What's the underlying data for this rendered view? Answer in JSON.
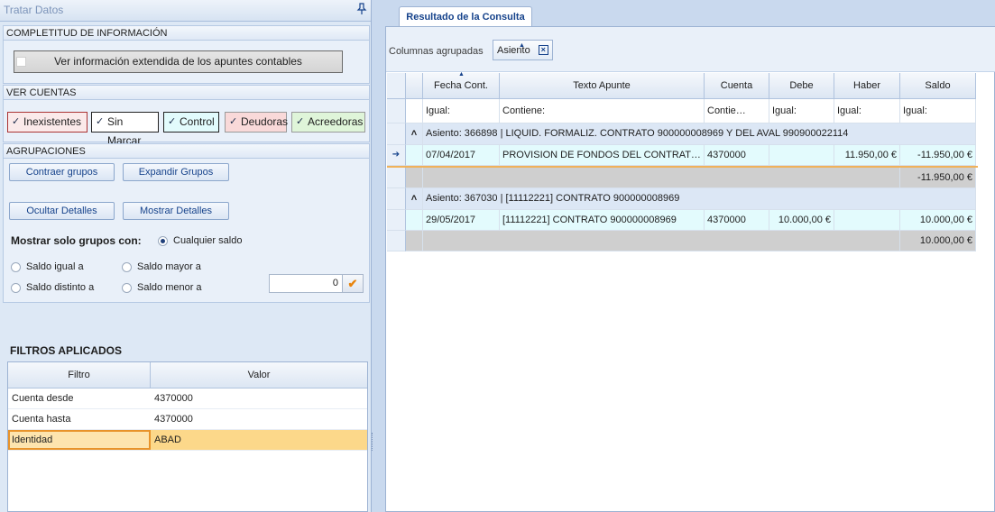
{
  "left_panel": {
    "title": "Tratar Datos",
    "completeness": {
      "header": "COMPLETITUD DE INFORMACIÓN",
      "extended_button": "Ver información extendida de los apuntes contables"
    },
    "accounts": {
      "header": "VER CUENTAS",
      "chips": [
        {
          "label": "Inexistentes",
          "checked": true,
          "color": "#fbeaea",
          "border": "#a33"
        },
        {
          "label": "Sin Marcar",
          "checked": true,
          "color": "#ffffff",
          "border": "#222"
        },
        {
          "label": "Control",
          "checked": true,
          "color": "#e2fbfc",
          "border": "#222"
        },
        {
          "label": "Deudoras",
          "checked": true,
          "color": "#f9d9d9",
          "border": "#999"
        },
        {
          "label": "Acreedoras",
          "checked": true,
          "color": "#dff5d9",
          "border": "#999"
        }
      ]
    },
    "groupings": {
      "header": "AGRUPACIONES",
      "collapse": "Contraer grupos",
      "expand": "Expandir Grupos",
      "hide_details": "Ocultar Detalles",
      "show_details": "Mostrar Detalles",
      "only_groups_label": "Mostrar solo grupos con:",
      "radio_any": "Cualquier saldo",
      "radio_equal": "Saldo igual a",
      "radio_greater": "Saldo mayor a",
      "radio_distinct": "Saldo distinto a",
      "radio_less": "Saldo menor a",
      "selected_radio": "Cualquier saldo",
      "amount_value": "0"
    },
    "filters": {
      "title": "FILTROS APLICADOS",
      "col_filter": "Filtro",
      "col_value": "Valor",
      "rows": [
        {
          "filter": "Cuenta desde",
          "value": "4370000"
        },
        {
          "filter": "Cuenta hasta",
          "value": "4370000"
        },
        {
          "filter": "Identidad",
          "value": "ABAD"
        }
      ]
    }
  },
  "right_panel": {
    "tab_label": "Resultado de la Consulta",
    "group_bar_label": "Columnas agrupadas",
    "group_chip": "Asiento",
    "columns": [
      "Fecha Cont.",
      "Texto Apunte",
      "Cuenta",
      "Debe",
      "Haber",
      "Saldo"
    ],
    "filters": [
      "Igual:",
      "Contiene:",
      "Contie…",
      "Igual:",
      "Igual:",
      "Igual:"
    ],
    "groups": [
      {
        "header": "Asiento: 366898 | LIQUID. FORMALIZ. CONTRATO 900000008969 Y DEL AVAL 990900022114",
        "rows": [
          {
            "fecha": "07/04/2017",
            "texto": "PROVISION DE FONDOS DEL CONTRATO...",
            "cuenta": "4370000",
            "debe": "",
            "haber": "11.950,00 €",
            "saldo": "-11.950,00 €"
          }
        ],
        "total": "-11.950,00 €"
      },
      {
        "header": "Asiento: 367030 | [11112221] CONTRATO 900000008969",
        "rows": [
          {
            "fecha": "29/05/2017",
            "texto": "[11112221] CONTRATO 900000008969",
            "cuenta": "4370000",
            "debe": "10.000,00 €",
            "haber": "",
            "saldo": "10.000,00 €"
          }
        ],
        "total": "10.000,00 €"
      }
    ]
  }
}
